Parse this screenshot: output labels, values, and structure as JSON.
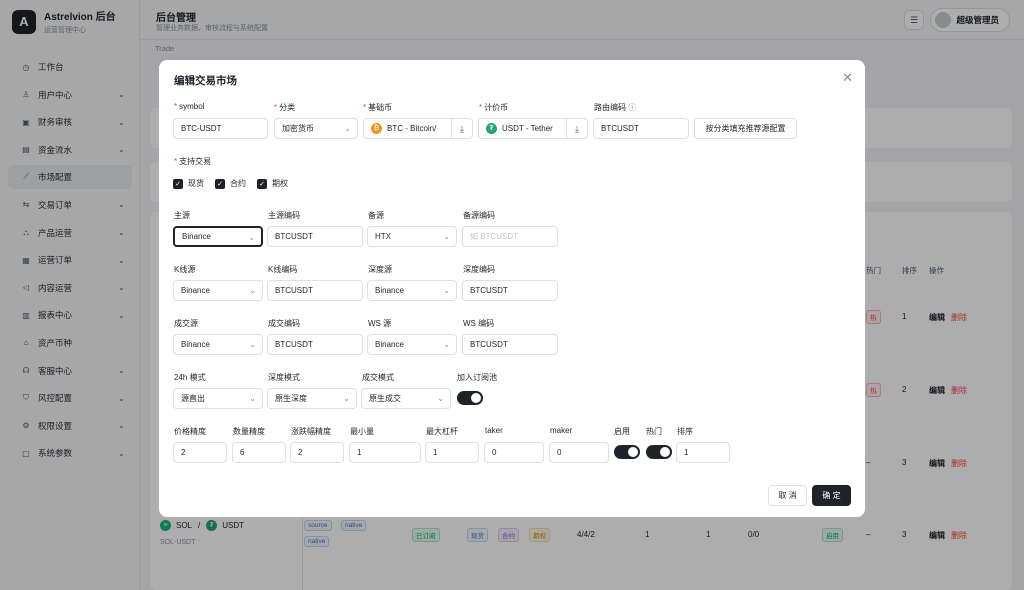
{
  "app": {
    "name": "Astrelvion 后台",
    "sub": "运营管理中心",
    "logo": "A"
  },
  "sidebar": {
    "items": [
      {
        "label": "工作台",
        "icon": "clock-icon",
        "chev": false
      },
      {
        "label": "用户中心",
        "icon": "user-icon",
        "chev": true
      },
      {
        "label": "财务审核",
        "icon": "audit-icon",
        "chev": true
      },
      {
        "label": "资金流水",
        "icon": "wallet-icon",
        "chev": true
      },
      {
        "label": "市场配置",
        "icon": "trend-icon",
        "chev": false,
        "active": true
      },
      {
        "label": "交易订单",
        "icon": "exchange-icon",
        "chev": true
      },
      {
        "label": "产品运营",
        "icon": "product-icon",
        "chev": true
      },
      {
        "label": "运营订单",
        "icon": "order-icon",
        "chev": true
      },
      {
        "label": "内容运营",
        "icon": "megaphone-icon",
        "chev": true
      },
      {
        "label": "报表中心",
        "icon": "chart-icon",
        "chev": true
      },
      {
        "label": "资产币种",
        "icon": "bank-icon",
        "chev": false
      },
      {
        "label": "客服中心",
        "icon": "headset-icon",
        "chev": true
      },
      {
        "label": "风控配置",
        "icon": "shield-icon",
        "chev": true
      },
      {
        "label": "权限设置",
        "icon": "gear-icon",
        "chev": true
      },
      {
        "label": "系统参数",
        "icon": "doc-icon",
        "chev": true
      }
    ]
  },
  "header": {
    "title": "后台管理",
    "sub": "管理业务数据、审核流程与系统配置",
    "user": "超级管理员",
    "breadcrumb": "Trade"
  },
  "bg_table": {
    "headers": {
      "hot": "热门",
      "sort": "排序",
      "action": "操作"
    },
    "rows": [
      {
        "hot": "热",
        "sort": "1"
      },
      {
        "hot": "热",
        "sort": "2"
      },
      {
        "hot": "–",
        "sort": "3"
      }
    ],
    "edit": "编辑",
    "del": "删除",
    "last": {
      "base": "SOL",
      "quote": "USDT",
      "sep": "/",
      "sub": "SOL-USDT",
      "tags": [
        "source",
        "native",
        "native"
      ],
      "status": "已订阅",
      "modes": [
        "现货",
        "合约",
        "期权"
      ],
      "prec": "4/4/2",
      "c1": "1",
      "c2": "1",
      "c3": "0/0",
      "enabled": "启用",
      "hot": "–",
      "sort": "3"
    }
  },
  "modal": {
    "title": "编辑交易市场",
    "labels": {
      "symbol": "symbol",
      "category": "分类",
      "base": "基础币",
      "quote": "计价币",
      "route": "路由编码",
      "support": "支持交易"
    },
    "symbol": "BTC-USDT",
    "category": "加密货币",
    "base": "BTC - Bitcoin/",
    "quote": "USDT - Tether",
    "route": "BTCUSDT",
    "fill_btn": "按分类填充推荐源配置",
    "trade_types": [
      "现货",
      "合约",
      "期权"
    ],
    "sources": {
      "main_label": "主源",
      "main": "Binance",
      "main_code_label": "主源编码",
      "main_code": "BTCUSDT",
      "backup_label": "备源",
      "backup": "HTX",
      "backup_code_label": "备源编码",
      "backup_code_ph": "如 BTCUSDT",
      "kline_label": "K线源",
      "kline": "Binance",
      "kline_code_label": "K线编码",
      "kline_code": "BTCUSDT",
      "depth_label": "深度源",
      "depth": "Binance",
      "depth_code_label": "深度编码",
      "depth_code": "BTCUSDT",
      "deal_label": "成交源",
      "deal": "Binance",
      "deal_code_label": "成交编码",
      "deal_code": "BTCUSDT",
      "ws_label": "WS 源",
      "ws": "Binance",
      "ws_code_label": "WS 编码",
      "ws_code": "BTCUSDT"
    },
    "modes": {
      "m24_label": "24h 模式",
      "m24": "源直出",
      "depth_mode_label": "深度模式",
      "depth_mode": "原生深度",
      "deal_mode_label": "成交模式",
      "deal_mode": "原生成交",
      "pool_label": "加入订阅池"
    },
    "params": {
      "price_prec_label": "价格精度",
      "price_prec": "2",
      "qty_prec_label": "数量精度",
      "qty_prec": "6",
      "chg_prec_label": "涨跌幅精度",
      "chg_prec": "2",
      "min_label": "最小量",
      "min": "1",
      "lev_label": "最大杠杆",
      "lev": "1",
      "taker_label": "taker",
      "taker": "0",
      "maker_label": "maker",
      "maker": "0",
      "enable_label": "启用",
      "hot_label": "热门",
      "sort_label": "排序",
      "sort": "1"
    },
    "cancel": "取 消",
    "ok": "确 定"
  },
  "colors": {
    "accent": "#1f2329",
    "danger": "#f53f3f",
    "btc": "#f7931a",
    "usdt": "#26a17b",
    "sol": "#14b87a"
  }
}
